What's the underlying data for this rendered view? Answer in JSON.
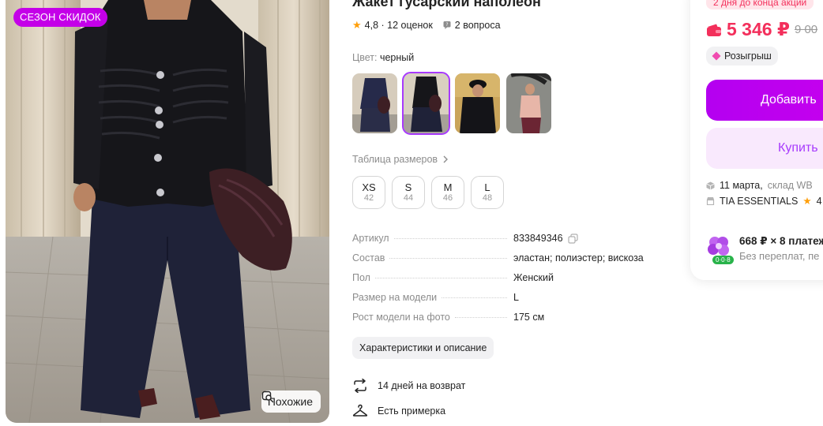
{
  "photo": {
    "sale_badge": "СЕЗОН СКИДОК",
    "similar_label": "Похожие"
  },
  "product": {
    "title": "Жакет гусарский наполеон",
    "rating": "4,8",
    "reviews": "· 12 оценок",
    "questions": "2 вопроса",
    "color_label": "Цвет:",
    "color_value": "черный",
    "size_table_label": "Таблица размеров",
    "sizes": [
      {
        "size": "XS",
        "ru": "42"
      },
      {
        "size": "S",
        "ru": "44"
      },
      {
        "size": "M",
        "ru": "46"
      },
      {
        "size": "L",
        "ru": "48"
      }
    ],
    "specs": [
      {
        "key": "Артикул",
        "value": "833849346"
      },
      {
        "key": "Состав",
        "value": "эластан; полиэстер; вискоза"
      },
      {
        "key": "Пол",
        "value": "Женский"
      },
      {
        "key": "Размер на модели",
        "value": "L"
      },
      {
        "key": "Рост модели на фото",
        "value": "175 см"
      }
    ],
    "characteristics_button": "Характеристики и описание",
    "features": {
      "return": "14 дней на возврат",
      "fitting": "Есть примерка"
    }
  },
  "buy_card": {
    "deadline": "2 дня до конца акции",
    "price": "5 346 ₽",
    "old_price": "9 00",
    "draw": "Розыгрыш",
    "add_button": "Добавить",
    "buy_button": "Купить",
    "delivery_date": "11 марта,",
    "warehouse": "склад WB",
    "seller": "TIA ESSENTIALS",
    "seller_rating": "4",
    "installment_badge": "0·0·8",
    "installment_title": "668 ₽ × 8 платеж",
    "installment_sub": "Без переплат, пе"
  },
  "colors": {
    "accent": "#a73afd",
    "price": "#f32f5b",
    "badge": "#c400e8",
    "star": "#ff9f0a"
  }
}
